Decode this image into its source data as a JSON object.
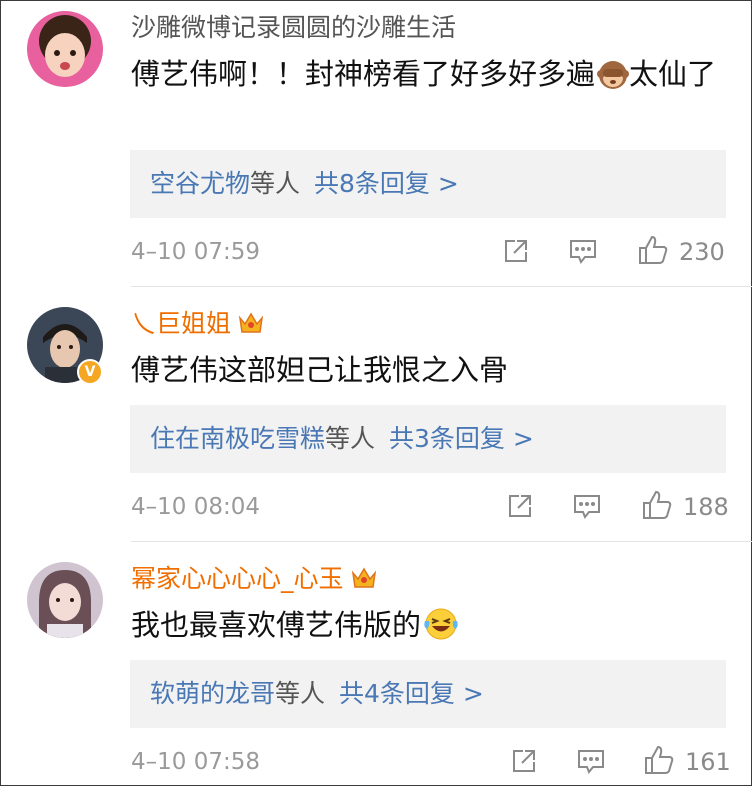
{
  "comments": [
    {
      "username": "沙雕微博记录圆圆的沙雕生活",
      "text": "傅艺伟啊！！封神榜看了好多好多遍",
      "text_tail": "太仙了",
      "replies": {
        "users": "空谷尤物",
        "mid": "等人",
        "count": "共8条回复 >"
      },
      "time": "4–10 07:59",
      "likes": "230"
    },
    {
      "username": "乀巨姐姐",
      "text": "傅艺伟这部妲己让我恨之入骨",
      "replies": {
        "users": "住在南极吃雪糕",
        "mid": "等人",
        "count": "共3条回复 >"
      },
      "time": "4–10 08:04",
      "likes": "188"
    },
    {
      "username": "幂家心心心心_心玉",
      "text": "我也最喜欢傅艺伟版的",
      "replies": {
        "users": "软萌的龙哥",
        "mid": "等人",
        "count": "共4条回复 >"
      },
      "time": "4–10 07:58",
      "likes": "161"
    }
  ],
  "icons": [
    "see-no-evil-monkey-icon",
    "laughing-crying-emoji-icon",
    "vip-crown-icon",
    "verified-badge-icon",
    "share-icon",
    "comment-icon",
    "like-icon"
  ],
  "colors": {
    "vip_name": "#f06e00",
    "link_blue": "#4a78b5",
    "meta_gray": "#9a9a9a"
  }
}
